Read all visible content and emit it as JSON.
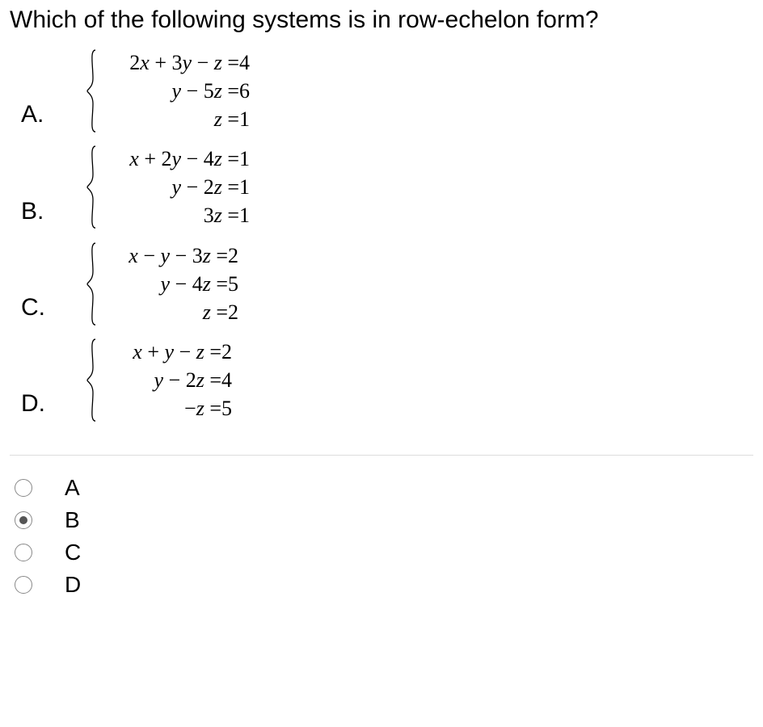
{
  "question": "Which of the following systems is in row-echelon form?",
  "options": [
    {
      "letter": "A.",
      "lhs_width": 172,
      "eqs": [
        {
          "lhs_html": "2<span class='var'>x</span> + 3<span class='var'>y</span> − <span class='var'>z</span> =",
          "rhs": " 4"
        },
        {
          "lhs_html": "<span class='var'>y</span> − 5<span class='var'>z</span> =",
          "rhs": " 6"
        },
        {
          "lhs_html": "<span class='var'>z</span> =",
          "rhs": " 1"
        }
      ]
    },
    {
      "letter": "B.",
      "lhs_width": 172,
      "eqs": [
        {
          "lhs_html": "<span class='var'>x</span> + 2<span class='var'>y</span> − 4<span class='var'>z</span> =",
          "rhs": " 1"
        },
        {
          "lhs_html": "<span class='var'>y</span> − 2<span class='var'>z</span> =",
          "rhs": " 1"
        },
        {
          "lhs_html": "3<span class='var'>z</span> =",
          "rhs": " 1"
        }
      ]
    },
    {
      "letter": "C.",
      "lhs_width": 158,
      "eqs": [
        {
          "lhs_html": "<span class='var'>x</span> − <span class='var'>y</span> − 3<span class='var'>z</span> =",
          "rhs": " 2"
        },
        {
          "lhs_html": "<span class='var'>y</span> − 4<span class='var'>z</span> =",
          "rhs": " 5"
        },
        {
          "lhs_html": "<span class='var'>z</span> =",
          "rhs": " 2"
        }
      ]
    },
    {
      "letter": "D.",
      "lhs_width": 150,
      "eqs": [
        {
          "lhs_html": "<span class='var'>x</span> + <span class='var'>y</span> − <span class='var'>z</span> =",
          "rhs": " 2"
        },
        {
          "lhs_html": "<span class='var'>y</span> − 2<span class='var'>z</span> =",
          "rhs": " 4"
        },
        {
          "lhs_html": "−<span class='var'>z</span> =",
          "rhs": " 5"
        }
      ]
    }
  ],
  "answers": [
    {
      "label": "A",
      "selected": false
    },
    {
      "label": "B",
      "selected": true
    },
    {
      "label": "C",
      "selected": false
    },
    {
      "label": "D",
      "selected": false
    }
  ]
}
